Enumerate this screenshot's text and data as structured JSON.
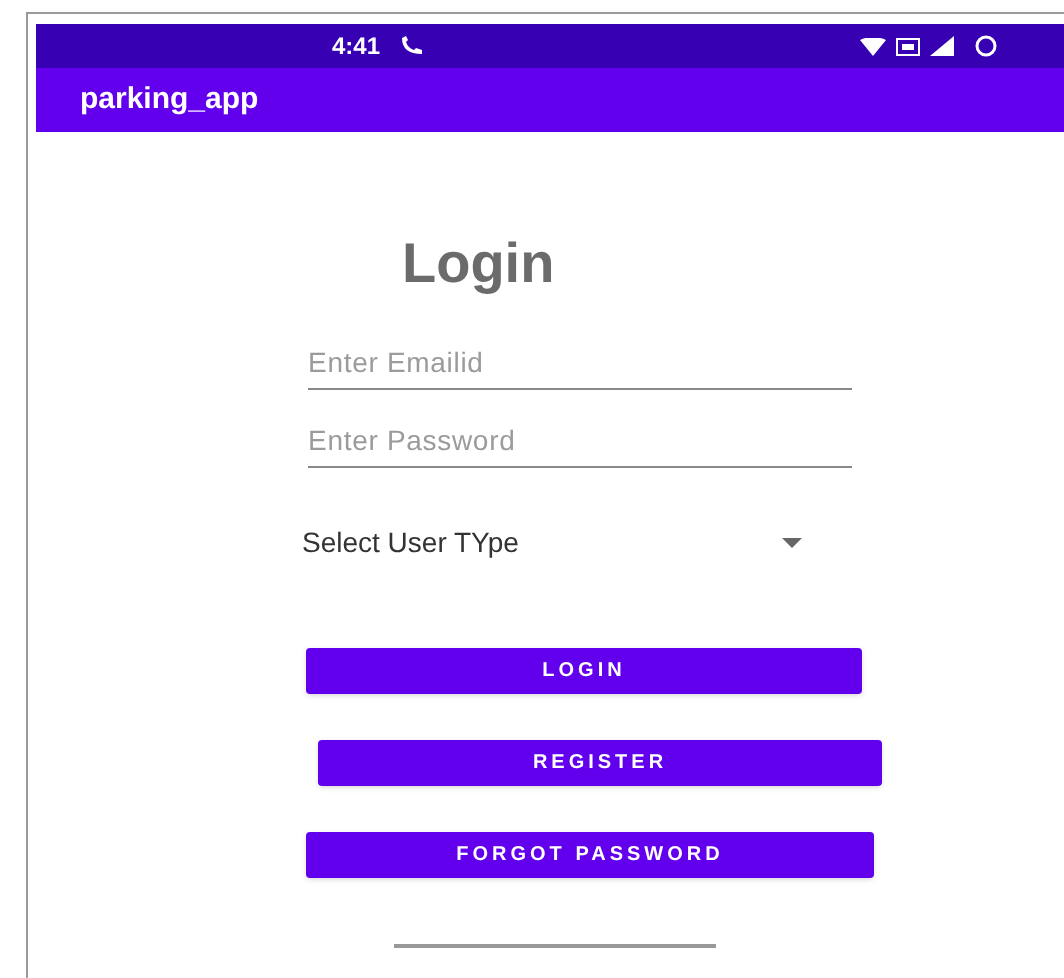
{
  "status_bar": {
    "time": "4:41"
  },
  "app_bar": {
    "title": "parking_app"
  },
  "heading": "Login",
  "fields": [
    {
      "placeholder": "Enter Emailid"
    },
    {
      "placeholder": "Enter Password"
    }
  ],
  "user_type_select": {
    "value": "Select User TYpe"
  },
  "buttons": [
    {
      "label": "LOGIN"
    },
    {
      "label": "REGISTER"
    },
    {
      "label": "FORGOT PASSWORD"
    }
  ]
}
